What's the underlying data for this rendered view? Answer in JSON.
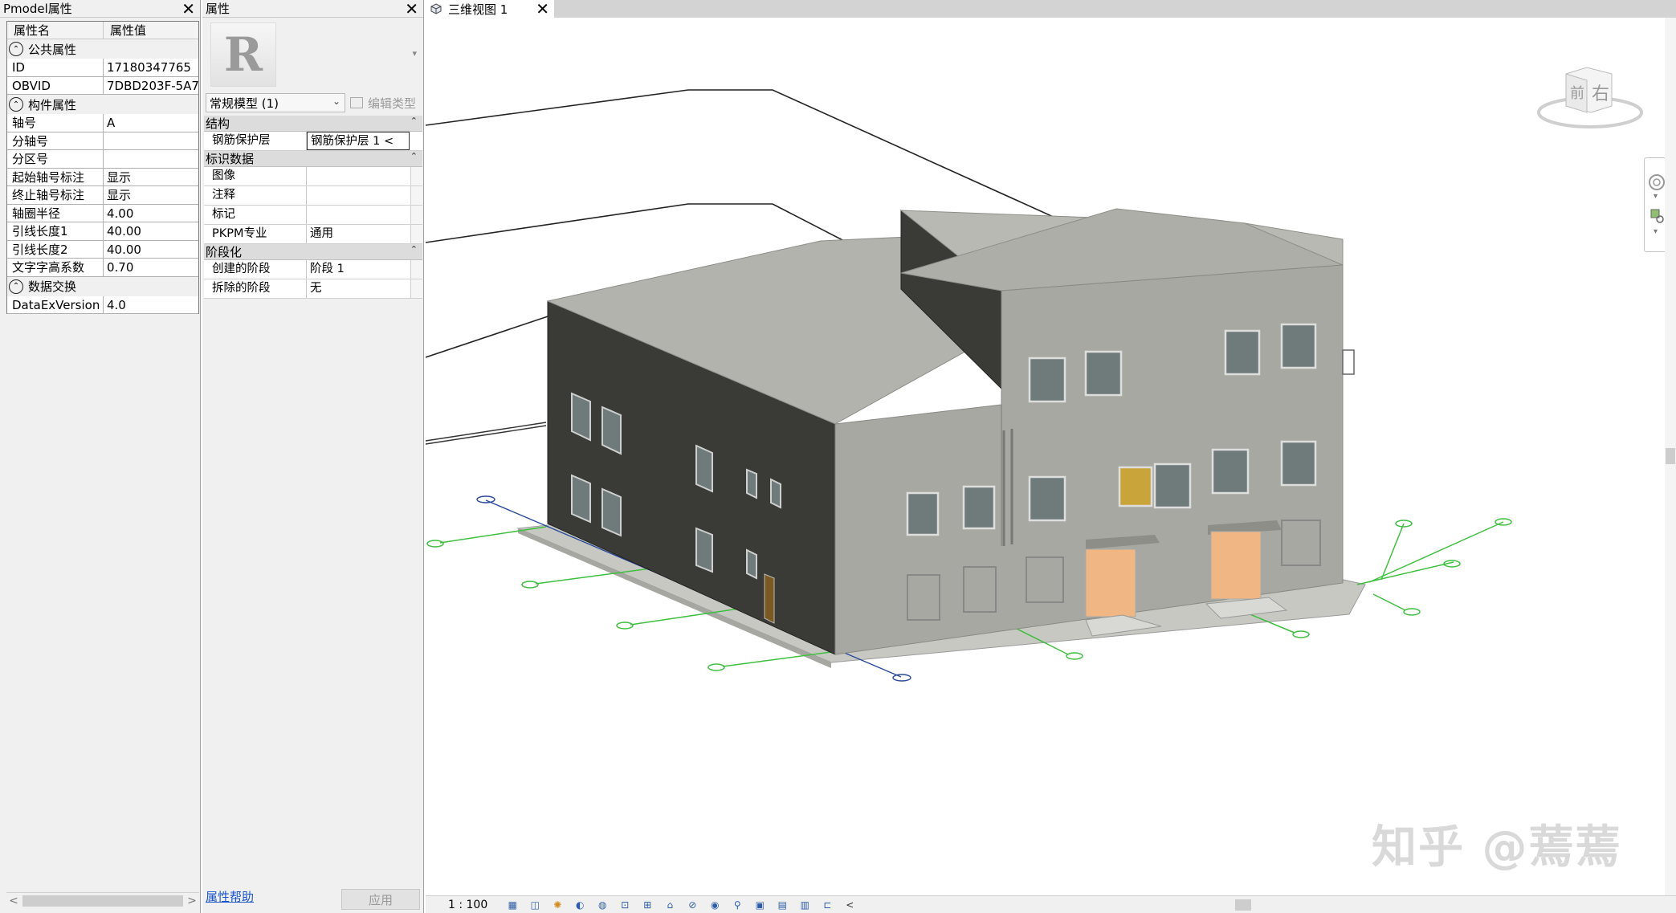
{
  "pmodel": {
    "title": "Pmodel属性",
    "columns": [
      "属性名",
      "属性值"
    ],
    "groups": [
      {
        "name": "公共属性",
        "rows": [
          [
            "ID",
            "17180347765"
          ],
          [
            "OBVID",
            "7DBD203F-5A7"
          ]
        ]
      },
      {
        "name": "构件属性",
        "rows": [
          [
            "轴号",
            "A"
          ],
          [
            "分轴号",
            ""
          ],
          [
            "分区号",
            ""
          ],
          [
            "起始轴号标注",
            "显示"
          ],
          [
            "终止轴号标注",
            "显示"
          ],
          [
            "轴圈半径",
            "4.00"
          ],
          [
            "引线长度1",
            "40.00"
          ],
          [
            "引线长度2",
            "40.00"
          ],
          [
            "文字字高系数",
            "0.70"
          ]
        ]
      },
      {
        "name": "数据交换",
        "rows": [
          [
            "DataExVersion",
            "4.0"
          ]
        ]
      }
    ]
  },
  "properties": {
    "title": "属性",
    "type_selector": "常规模型 (1)",
    "edit_type": "编辑类型",
    "groups": [
      {
        "name": "结构",
        "rows": [
          [
            "钢筋保护层",
            "钢筋保护层 1 <"
          ]
        ]
      },
      {
        "name": "标识数据",
        "rows": [
          [
            "图像",
            ""
          ],
          [
            "注释",
            ""
          ],
          [
            "标记",
            ""
          ],
          [
            "PKPM专业",
            "通用"
          ]
        ]
      },
      {
        "name": "阶段化",
        "rows": [
          [
            "创建的阶段",
            "阶段 1"
          ],
          [
            "拆除的阶段",
            "无"
          ]
        ]
      }
    ],
    "help_link": "属性帮助",
    "apply": "应用"
  },
  "view": {
    "tab_title": "三维视图 1",
    "scale": "1 : 100",
    "viewcube_front": "前",
    "viewcube_right": "右"
  },
  "watermark": "知乎 @蔫蔫"
}
